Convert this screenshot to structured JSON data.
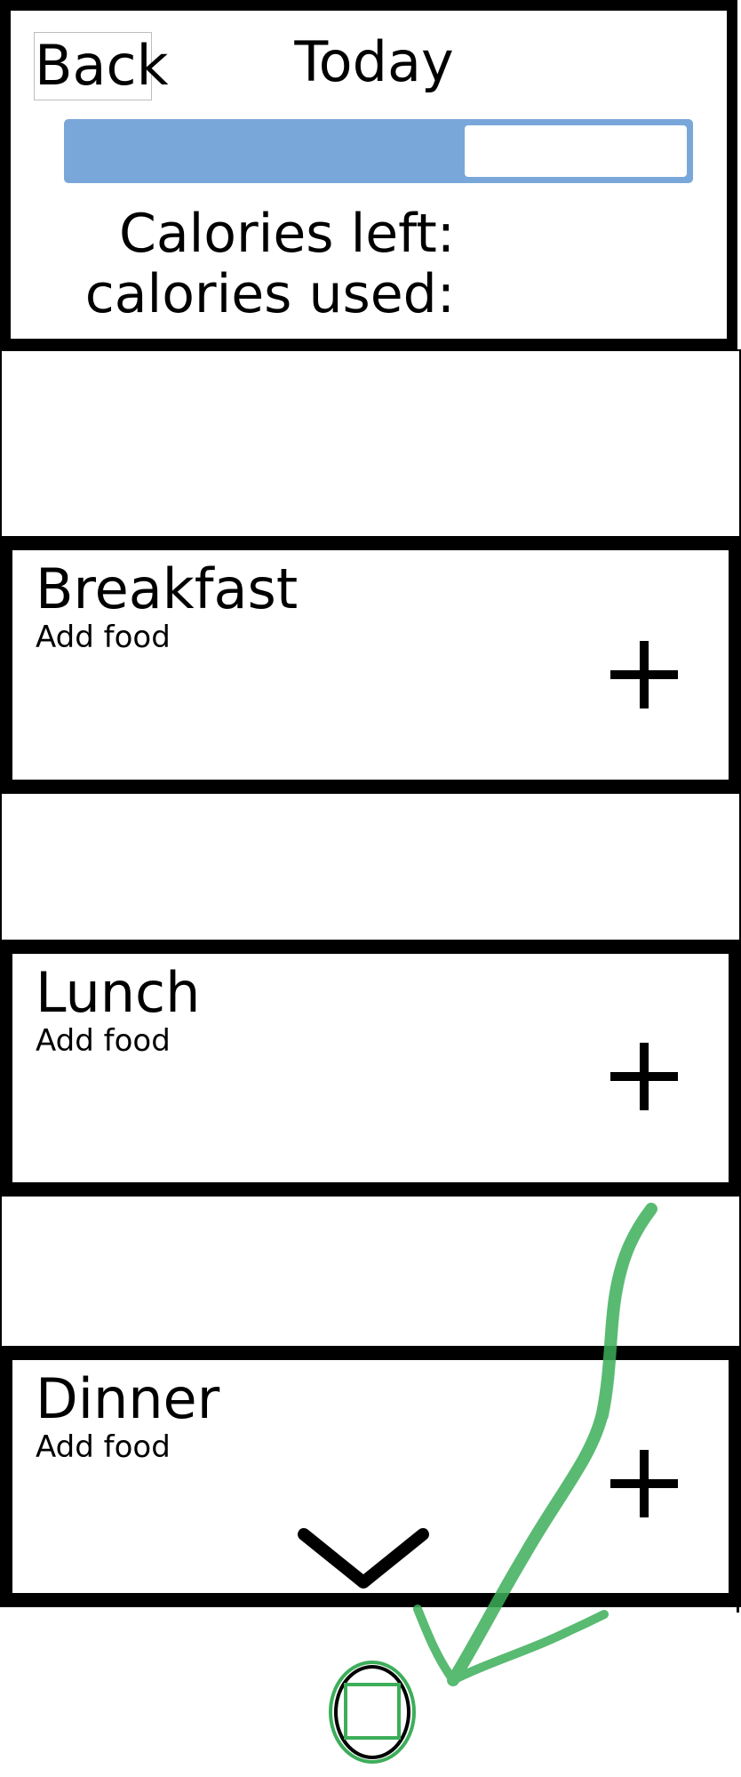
{
  "header": {
    "back_label": "Back",
    "title": "Today",
    "progress_fraction": 0.64,
    "calories_left_label": "Calories left:",
    "calories_used_label": "calories used:"
  },
  "meals": [
    {
      "title": "Breakfast",
      "subtitle": "Add food"
    },
    {
      "title": "Lunch",
      "subtitle": "Add food"
    },
    {
      "title": "Dinner",
      "subtitle": "Add food"
    }
  ],
  "icons": {
    "add": "plus-icon",
    "expand": "chevron-down-icon",
    "home": "home-button-icon",
    "annotation": "arrow-annotation"
  },
  "colors": {
    "accent": "#7aa7da",
    "annotation": "#3dae5a",
    "border": "#000000"
  }
}
